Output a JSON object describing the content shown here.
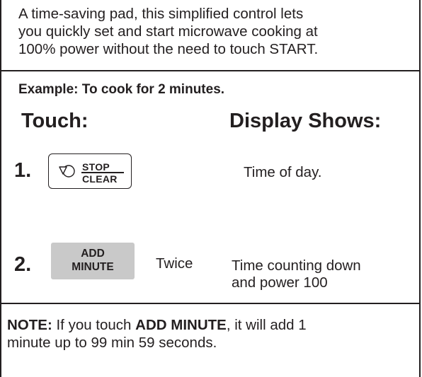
{
  "intro": {
    "lines": [
      "A time-saving pad, this simplified control lets",
      "you quickly set and start microwave cooking at",
      "100% power without the need to touch START."
    ]
  },
  "example": "Example: To cook for 2 minutes.",
  "headers": {
    "touch": "Touch:",
    "display": "Display Shows:"
  },
  "steps": [
    {
      "number": "1.",
      "button": {
        "icon": "stop-clear-icon",
        "top": "STOP",
        "bottom": "CLEAR"
      },
      "display": "Time of day."
    },
    {
      "number": "2.",
      "button": {
        "top": "ADD",
        "bottom": "MINUTE"
      },
      "repeat": "Twice",
      "display_lines": [
        "Time counting down",
        "and power 100"
      ]
    }
  ],
  "note": {
    "label": "NOTE:",
    "text1": " If you touch ",
    "bold": "ADD MINUTE",
    "text2": ", it will add 1",
    "line2": "minute up to 99 min 59 seconds."
  },
  "colors": {
    "text": "#231f20",
    "button_fill": "#c9c9c9"
  }
}
